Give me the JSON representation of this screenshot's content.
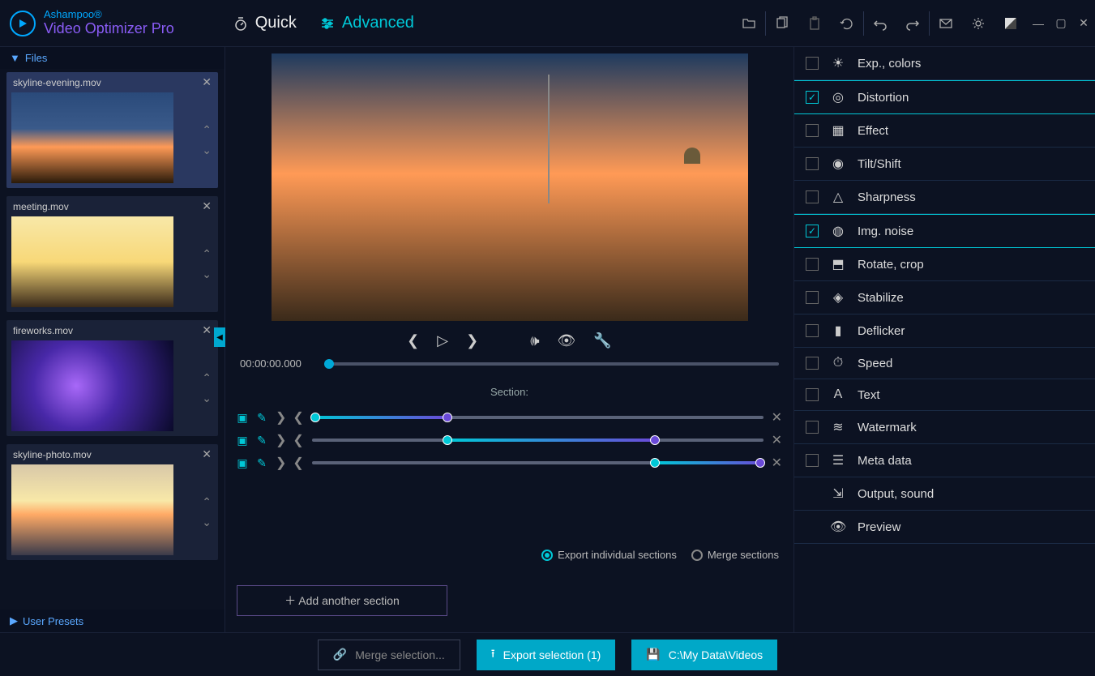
{
  "app": {
    "brand": "Ashampoo®",
    "name": "Video Optimizer Pro"
  },
  "modes": {
    "quick": "Quick",
    "advanced": "Advanced"
  },
  "sidebar": {
    "files_header": "Files",
    "presets_header": "User Presets",
    "files": [
      {
        "name": "skyline-evening.mov"
      },
      {
        "name": "meeting.mov"
      },
      {
        "name": "fireworks.mov"
      },
      {
        "name": "skyline-photo.mov"
      }
    ]
  },
  "preview": {
    "timecode": "00:00:00.000",
    "section_label": "Section:"
  },
  "add_section": "Add another section",
  "export_opts": {
    "individual": "Export individual sections",
    "merge": "Merge sections"
  },
  "tools": [
    {
      "label": "Exp., colors",
      "checked": false
    },
    {
      "label": "Distortion",
      "checked": true
    },
    {
      "label": "Effect",
      "checked": false
    },
    {
      "label": "Tilt/Shift",
      "checked": false
    },
    {
      "label": "Sharpness",
      "checked": false
    },
    {
      "label": "Img. noise",
      "checked": true
    },
    {
      "label": "Rotate, crop",
      "checked": false
    },
    {
      "label": "Stabilize",
      "checked": false
    },
    {
      "label": "Deflicker",
      "checked": false
    },
    {
      "label": "Speed",
      "checked": false
    },
    {
      "label": "Text",
      "checked": false
    },
    {
      "label": "Watermark",
      "checked": false
    },
    {
      "label": "Meta data",
      "checked": false
    },
    {
      "label": "Output, sound",
      "nocheck": true
    },
    {
      "label": "Preview",
      "nocheck": true
    }
  ],
  "footer": {
    "merge": "Merge selection...",
    "export": "Export selection (1)",
    "path": "C:\\My Data\\Videos"
  }
}
